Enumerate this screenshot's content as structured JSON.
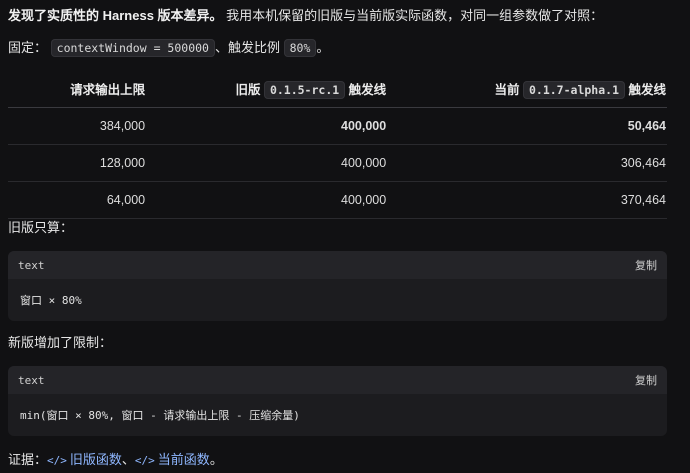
{
  "intro": {
    "bold": "发现了实质性的 Harness 版本差异。",
    "rest": " 我用本机保留的旧版与当前版实际函数，对同一组参数做了对照："
  },
  "fixed": {
    "prefix": "固定：",
    "code1": "contextWindow = 500000",
    "mid": "、触发比例",
    "code2": "80%",
    "suffix": "。"
  },
  "table": {
    "headers": {
      "col1": "请求输出上限",
      "col2_pre": "旧版",
      "col2_code": "0.1.5-rc.1",
      "col2_post": "触发线",
      "col3_pre": "当前",
      "col3_code": "0.1.7-alpha.1",
      "col3_post": "触发线"
    },
    "rows": [
      {
        "a": "384,000",
        "b": "400,000",
        "c": "50,464"
      },
      {
        "a": "128,000",
        "b": "400,000",
        "c": "306,464"
      },
      {
        "a": "64,000",
        "b": "400,000",
        "c": "370,464"
      }
    ]
  },
  "old_label": "旧版只算：",
  "block1": {
    "lang": "text",
    "copy": "复制",
    "code": "窗口 × 80%"
  },
  "new_label": "新版增加了限制：",
  "block2": {
    "lang": "text",
    "copy": "复制",
    "code": "min(窗口 × 80%, 窗口 - 请求输出上限 - 压缩余量)"
  },
  "evidence": {
    "prefix": "证据：",
    "icon": "</>",
    "link1": "旧版函数",
    "sep": "、",
    "link2": "当前函数",
    "suffix": "。"
  }
}
